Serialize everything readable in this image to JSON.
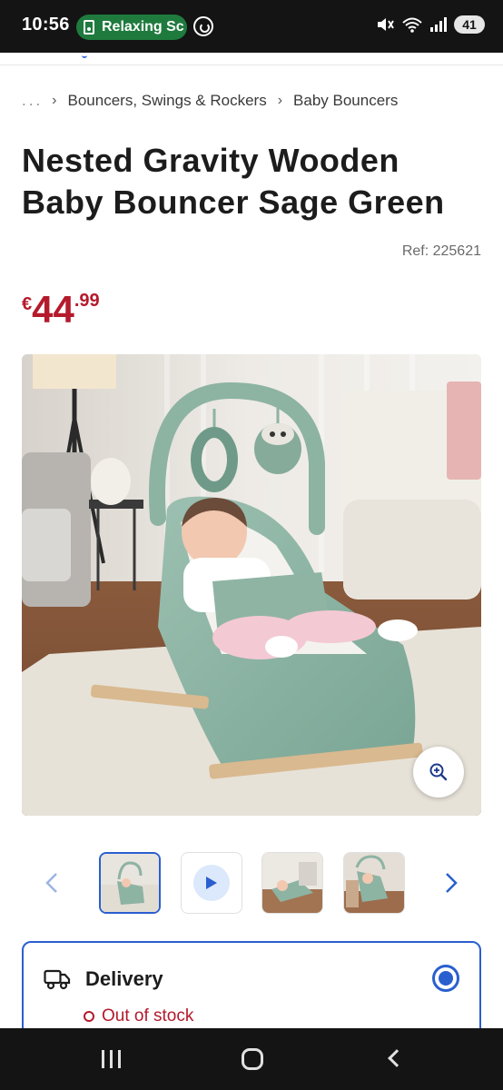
{
  "status_bar": {
    "time": "10:56",
    "app_pill_label": "Relaxing Sc",
    "battery": "41"
  },
  "breadcrumb": {
    "ellipsis": "...",
    "items": [
      "Bouncers, Swings & Rockers",
      "Baby Bouncers"
    ]
  },
  "product": {
    "title": "Nested Gravity Wooden Baby Bouncer Sage Green",
    "ref": "Ref: 225621",
    "price": {
      "currency": "€",
      "main": "44",
      "cents": ".99"
    }
  },
  "gallery": {
    "thumbnails": [
      {
        "kind": "image",
        "selected": true
      },
      {
        "kind": "video",
        "selected": false
      },
      {
        "kind": "image",
        "selected": false
      },
      {
        "kind": "image",
        "selected": false
      }
    ]
  },
  "delivery": {
    "title": "Delivery",
    "stock_status": "Out of stock"
  },
  "colors": {
    "accent_blue": "#2a5fcf",
    "price_red": "#b41a2c",
    "bouncer_green": "#8db3a3",
    "status_green": "#1f7a3e"
  },
  "icons": {
    "zoom": "zoom-in-icon",
    "delivery": "truck-icon",
    "prev": "chevron-left-icon",
    "next": "chevron-right-icon",
    "play": "play-icon"
  }
}
